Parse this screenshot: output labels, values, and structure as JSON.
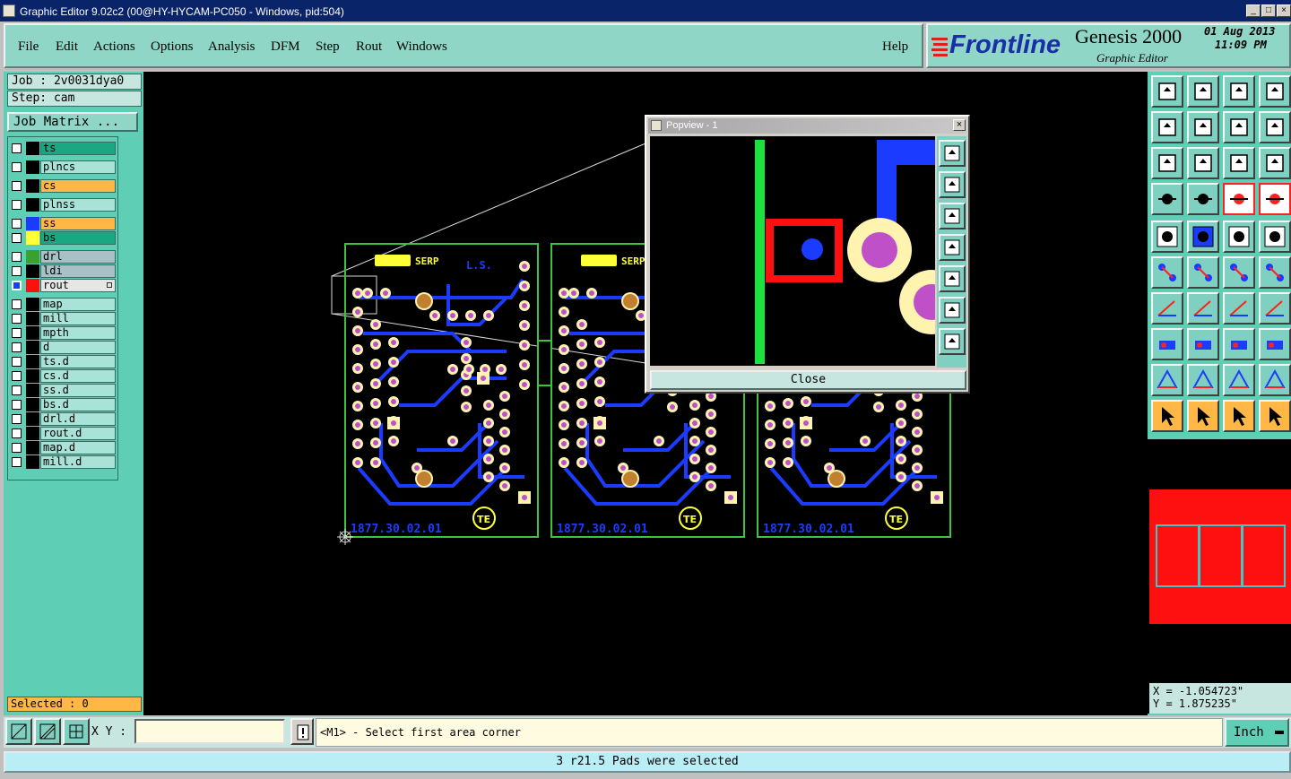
{
  "window": {
    "title": "Graphic Editor 9.02c2 (00@HY-HYCAM-PC050 - Windows, pid:504)"
  },
  "menu": {
    "items": [
      "File",
      "Edit",
      "Actions",
      "Options",
      "Analysis",
      "DFM",
      "Step",
      "Rout",
      "Windows"
    ],
    "help": "Help"
  },
  "branding": {
    "brand": "Frontline",
    "product": "Genesis 2000",
    "subtitle": "Graphic Editor",
    "date": "01 Aug 2013",
    "time": "11:09 PM"
  },
  "job": {
    "job_label": "Job : 2v0031dya0",
    "step_label": "Step: cam",
    "matrix_button": "Job Matrix ..."
  },
  "layers": [
    {
      "name": "ts",
      "bg": "#19a882",
      "swatch": "#000000"
    },
    {
      "name": "plncs",
      "bg": "#a9e3d7",
      "swatch": "#000000"
    },
    {
      "name": "cs",
      "bg": "#ffb746",
      "swatch": "#000000"
    },
    {
      "name": "plnss",
      "bg": "#a9e3d7",
      "swatch": "#000000"
    },
    {
      "name": "ss",
      "bg": "#ffb746",
      "swatch": "#1b3cff"
    },
    {
      "name": "bs",
      "bg": "#19a882",
      "swatch": "#ffff38"
    },
    {
      "name": "drl",
      "bg": "#a9c1c6",
      "swatch": "#3aa030"
    },
    {
      "name": "ldi",
      "bg": "#a9c1c6",
      "swatch": "#000000"
    },
    {
      "name": "rout",
      "bg": "#e6e6e6",
      "swatch": "#ff1010",
      "selected": true
    },
    {
      "name": "map",
      "bg": "#a9e3d7",
      "swatch": "#000000"
    },
    {
      "name": "mill",
      "bg": "#a9e3d7",
      "swatch": "#000000"
    },
    {
      "name": "mpth",
      "bg": "#a9e3d7",
      "swatch": "#000000"
    },
    {
      "name": "d",
      "bg": "#a9e3d7",
      "swatch": "#000000"
    },
    {
      "name": "ts.d",
      "bg": "#a9e3d7",
      "swatch": "#000000"
    },
    {
      "name": "cs.d",
      "bg": "#a9e3d7",
      "swatch": "#000000"
    },
    {
      "name": "ss.d",
      "bg": "#a9e3d7",
      "swatch": "#000000"
    },
    {
      "name": "bs.d",
      "bg": "#a9e3d7",
      "swatch": "#000000"
    },
    {
      "name": "drl.d",
      "bg": "#a9e3d7",
      "swatch": "#000000"
    },
    {
      "name": "rout.d",
      "bg": "#a9e3d7",
      "swatch": "#000000"
    },
    {
      "name": "map.d",
      "bg": "#a9e3d7",
      "swatch": "#000000"
    },
    {
      "name": "mill.d",
      "bg": "#a9e3d7",
      "swatch": "#000000"
    }
  ],
  "selected_count": "Selected : 0",
  "board": {
    "panel_text": "1877.30.02.01",
    "logo_text": "TE",
    "top_label": "SERP",
    "top_label_2": "L.S."
  },
  "popview": {
    "title": "Popview - 1",
    "close_label": "Close"
  },
  "coords": {
    "x": "X = -1.054723\"",
    "y": "Y = 1.875235\""
  },
  "command": {
    "xy_label": "X Y :",
    "xy_value": "",
    "prompt": "<M1> - Select first area corner",
    "units": "Inch"
  },
  "status": {
    "message": "3 r21.5 Pads were selected"
  },
  "colors": {
    "canvas": "#000000",
    "panel": "#5ecfb4",
    "trace": "#1b3cff",
    "outline": "#3cc43c",
    "pad_ring": "#fff3b0",
    "pad_center": "#c050c8",
    "highlight": "#ff1010"
  }
}
